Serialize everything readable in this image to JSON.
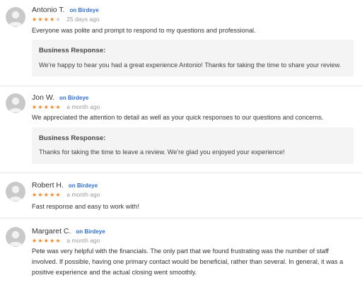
{
  "colors": {
    "accent_link": "#2f6fd6",
    "star_filled": "#f5821f",
    "star_empty": "#c8c8c8",
    "response_bg": "#f4f4f4"
  },
  "reviews": [
    {
      "name": "Antonio T.",
      "source": "on Birdeye",
      "rating": 4,
      "stars": "★★★★",
      "stars_empty": "★",
      "date": "25 days ago",
      "text": "Everyone was polite and prompt to respond to my questions and professional.",
      "response_title": "Business Response:",
      "response_text": "We're happy to hear you had a great experience Antonio! Thanks for taking the time to share your review."
    },
    {
      "name": "Jon W.",
      "source": "on Birdeye",
      "rating": 5,
      "stars": "★★★★★",
      "stars_empty": "",
      "date": "a month ago",
      "text": "We appreciated the attention to detail as well as your quick responses to our questions and concerns.",
      "response_title": "Business Response:",
      "response_text": "Thanks for taking the time to leave a review. We're glad you enjoyed your experience!"
    },
    {
      "name": "Robert H.",
      "source": "on Birdeye",
      "rating": 5,
      "stars": "★★★★★",
      "stars_empty": "",
      "date": "a month ago",
      "text": "Fast response and easy to work with!"
    },
    {
      "name": "Margaret C.",
      "source": "on Birdeye",
      "rating": 5,
      "stars": "★★★★★",
      "stars_empty": "",
      "date": "a month ago",
      "text_lines": [
        "Pete was very helpful with the financials. The only part that we found frustrating was the number of staff",
        "involved. If possible, having one primary contact would be beneficial, rather than several. In general, it was a",
        "positive experience and the actual closing went smoothly."
      ]
    }
  ]
}
